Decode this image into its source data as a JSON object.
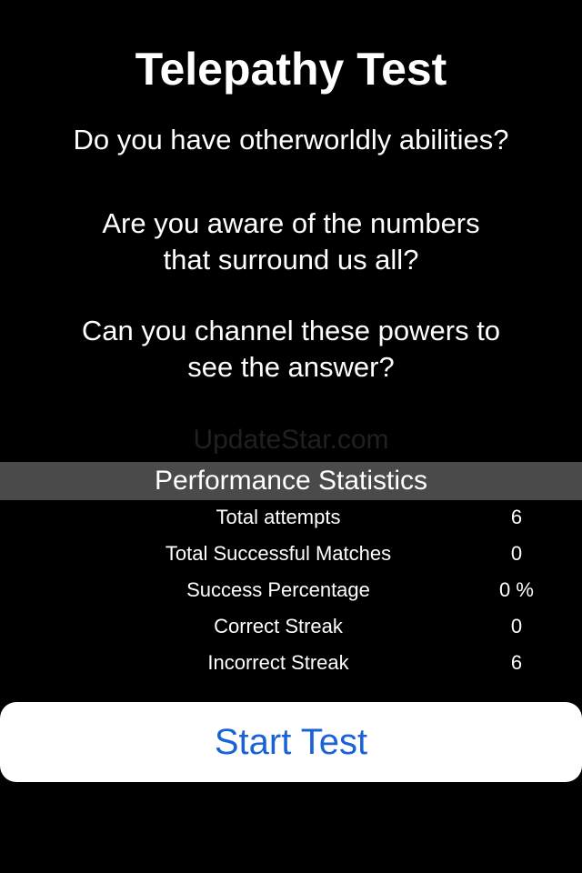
{
  "title": "Telepathy Test",
  "intro": {
    "line1": "Do you have otherworldly abilities?",
    "line2a": "Are you aware of the numbers",
    "line2b": "that surround us all?",
    "line3a": "Can you channel these powers to",
    "line3b": "see the answer?"
  },
  "watermark": "UpdateStar.com",
  "stats": {
    "header": "Performance Statistics",
    "rows": [
      {
        "label": "Total attempts",
        "value": "6"
      },
      {
        "label": "Total Successful Matches",
        "value": "0"
      },
      {
        "label": "Success Percentage",
        "value": "0 %"
      },
      {
        "label": "Correct Streak",
        "value": "0"
      },
      {
        "label": "Incorrect Streak",
        "value": "6"
      }
    ]
  },
  "start_button": {
    "label": "Start Test",
    "color": "#1a63d6"
  }
}
